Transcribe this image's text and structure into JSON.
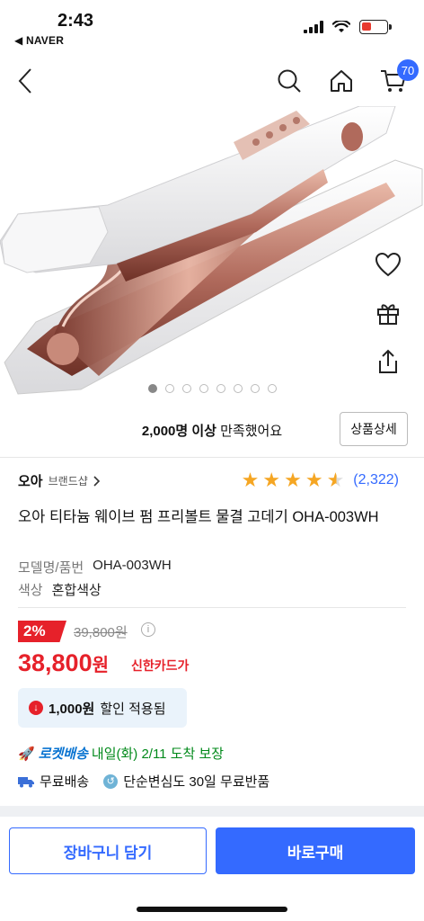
{
  "status_bar": {
    "time": "2:43",
    "back_app": "◀ NAVER"
  },
  "nav": {
    "cart_count": "70"
  },
  "gallery": {
    "total_images": 8,
    "active_index": 0
  },
  "satisfaction": {
    "count": "2,000명 이상",
    "suffix": " 만족했어요",
    "detail_button": "상품상세"
  },
  "product": {
    "brand": "오아",
    "brand_shop": "브랜드샵",
    "rating": 4.5,
    "review_count": "(2,322)",
    "title": "오아 티타늄 웨이브 펌 프리볼트 물결 고데기 OHA-003WH",
    "model_label": "모델명/품번",
    "model_value": "OHA-003WH",
    "color_label": "색상",
    "color_value": "혼합색상"
  },
  "price": {
    "discount": "2%",
    "original": "39,800원",
    "sale_number": "38,800",
    "sale_unit": "원",
    "card": "신한카드가",
    "coupon_amount": "1,000원",
    "coupon_suffix": "할인 적용됨"
  },
  "delivery": {
    "rocket_label": "로켓배송",
    "arrival": "내일(화) 2/11 도착 보장",
    "free_shipping": "무료배송",
    "free_return": "단순변심도 30일 무료반품"
  },
  "actions": {
    "add_to_cart": "장바구니 담기",
    "buy_now": "바로구매"
  },
  "colors": {
    "accent": "#346aff",
    "sale": "#e6212a",
    "rocket": "#0a74d1",
    "arrival": "#00891a",
    "star": "#f5a623"
  }
}
